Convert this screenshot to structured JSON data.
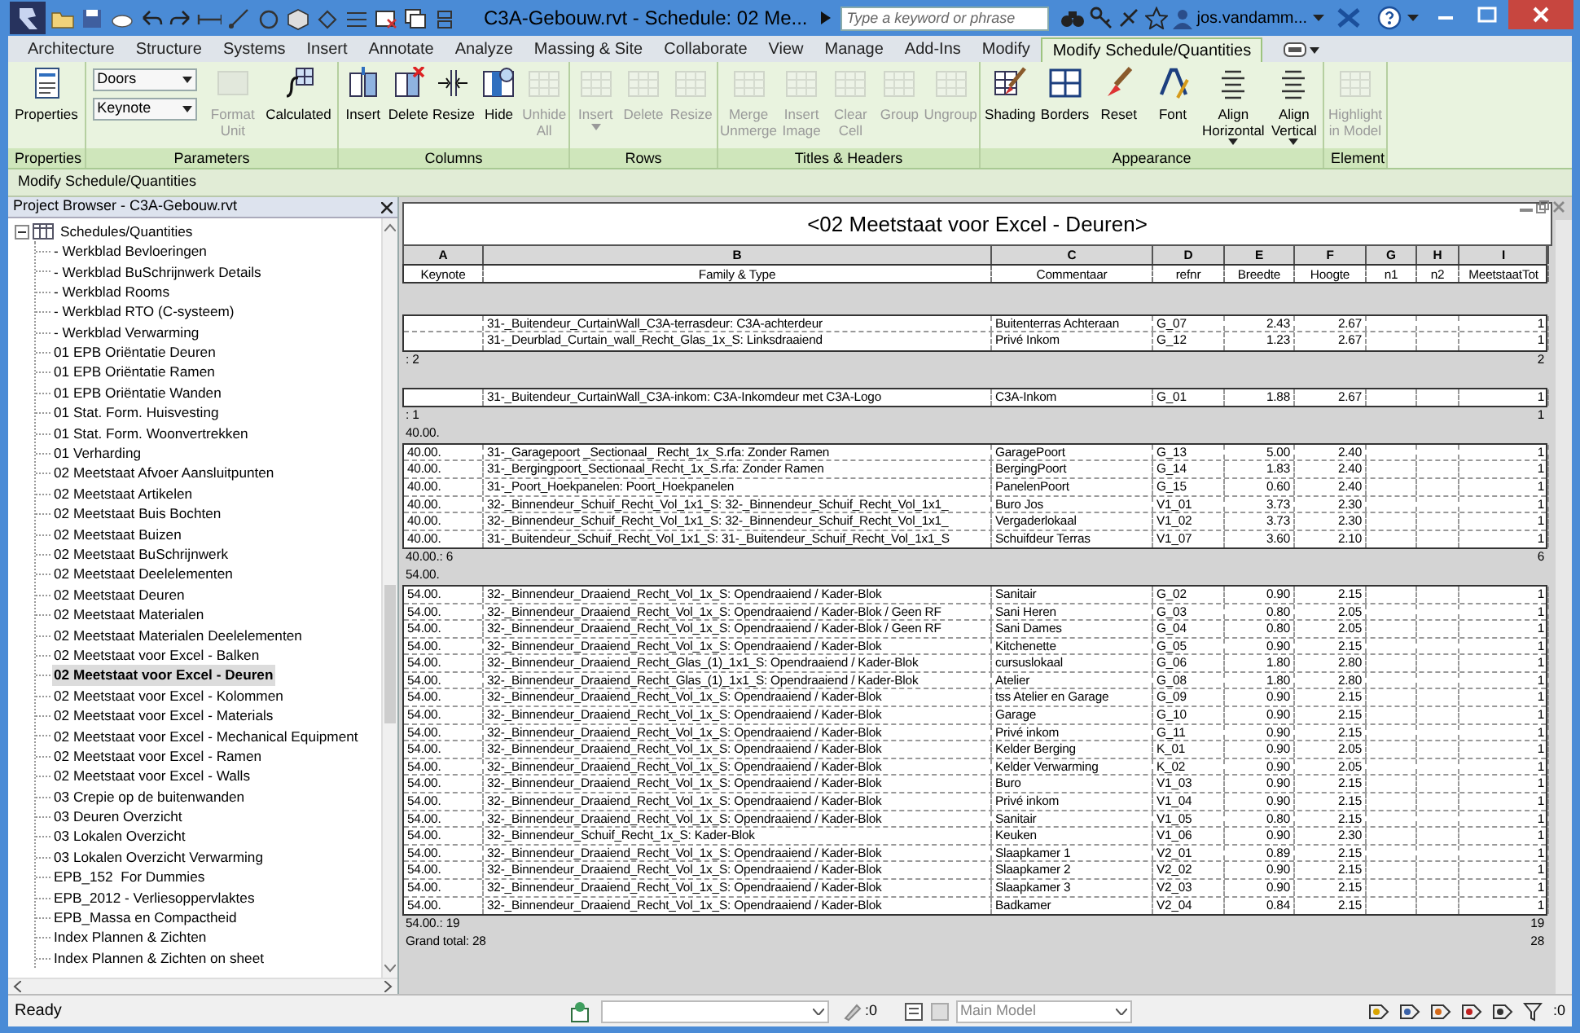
{
  "window": {
    "title": "C3A-Gebouw.rvt - Schedule: 02 Me...",
    "search_placeholder": "Type a keyword or phrase",
    "user": "jos.vandamm..."
  },
  "ribbon_tabs": [
    {
      "label": "Architecture",
      "selected": false
    },
    {
      "label": "Structure",
      "selected": false
    },
    {
      "label": "Systems",
      "selected": false
    },
    {
      "label": "Insert",
      "selected": false
    },
    {
      "label": "Annotate",
      "selected": false
    },
    {
      "label": "Analyze",
      "selected": false
    },
    {
      "label": "Massing & Site",
      "selected": false
    },
    {
      "label": "Collaborate",
      "selected": false
    },
    {
      "label": "View",
      "selected": false
    },
    {
      "label": "Manage",
      "selected": false
    },
    {
      "label": "Add-Ins",
      "selected": false
    },
    {
      "label": "Modify",
      "selected": false
    },
    {
      "label": "Modify Schedule/Quantities",
      "selected": true
    }
  ],
  "ribbon_panels": [
    {
      "title": "Properties",
      "buttons": [
        {
          "label": "Properties",
          "disabled": false,
          "has_menu": false
        }
      ]
    },
    {
      "title": "Parameters",
      "dropdowns": [
        "Doors",
        "Keynote"
      ],
      "buttons": [
        {
          "label": "Format Unit",
          "disabled": true,
          "has_menu": false
        },
        {
          "label": "Calculated",
          "disabled": false,
          "has_menu": false
        }
      ]
    },
    {
      "title": "Columns",
      "buttons": [
        {
          "label": "Insert",
          "disabled": false,
          "has_menu": false
        },
        {
          "label": "Delete",
          "disabled": false,
          "has_menu": false
        },
        {
          "label": "Resize",
          "disabled": false,
          "has_menu": false
        },
        {
          "label": "Hide",
          "disabled": false,
          "has_menu": false
        },
        {
          "label": "Unhide All",
          "disabled": true,
          "has_menu": false
        }
      ]
    },
    {
      "title": "Rows",
      "buttons": [
        {
          "label": "Insert",
          "disabled": true,
          "has_menu": true
        },
        {
          "label": "Delete",
          "disabled": true,
          "has_menu": false
        },
        {
          "label": "Resize",
          "disabled": true,
          "has_menu": false
        }
      ]
    },
    {
      "title": "Titles & Headers",
      "buttons": [
        {
          "label": "Merge Unmerge",
          "disabled": true,
          "has_menu": false
        },
        {
          "label": "Insert Image",
          "disabled": true,
          "has_menu": false
        },
        {
          "label": "Clear Cell",
          "disabled": true,
          "has_menu": false
        },
        {
          "label": "Group",
          "disabled": true,
          "has_menu": false
        },
        {
          "label": "Ungroup",
          "disabled": true,
          "has_menu": false
        }
      ]
    },
    {
      "title": "Appearance",
      "buttons": [
        {
          "label": "Shading",
          "disabled": false,
          "has_menu": false
        },
        {
          "label": "Borders",
          "disabled": false,
          "has_menu": false
        },
        {
          "label": "Reset",
          "disabled": false,
          "has_menu": false
        },
        {
          "label": "Font",
          "disabled": false,
          "has_menu": false
        },
        {
          "label": "Align Horizontal",
          "disabled": false,
          "has_menu": true
        },
        {
          "label": "Align Vertical",
          "disabled": false,
          "has_menu": true
        }
      ]
    },
    {
      "title": "Element",
      "buttons": [
        {
          "label": "Highlight in Model",
          "disabled": true,
          "has_menu": false
        }
      ]
    }
  ],
  "options_bar": "Modify Schedule/Quantities",
  "project_browser": {
    "title": "Project Browser - C3A-Gebouw.rvt",
    "tree": [
      {
        "label": "Schedules/Quantities",
        "expanded": true,
        "selected": false,
        "children": [
          {
            "label": "- Werkblad Bevloeringen",
            "selected": false
          },
          {
            "label": "- Werkblad BuSchrijnwerk Details",
            "selected": false
          },
          {
            "label": "- Werkblad Rooms",
            "selected": false
          },
          {
            "label": "- Werkblad RTO (C-systeem)",
            "selected": false
          },
          {
            "label": "- Werkblad Verwarming",
            "selected": false
          },
          {
            "label": "01 EPB Oriëntatie Deuren",
            "selected": false
          },
          {
            "label": "01 EPB Oriëntatie Ramen",
            "selected": false
          },
          {
            "label": "01 EPB Oriëntatie Wanden",
            "selected": false
          },
          {
            "label": "01 Stat. Form. Huisvesting",
            "selected": false
          },
          {
            "label": "01 Stat. Form. Woonvertrekken",
            "selected": false
          },
          {
            "label": "01 Verharding",
            "selected": false
          },
          {
            "label": "02 Meetstaat Afvoer Aansluitpunten",
            "selected": false
          },
          {
            "label": "02 Meetstaat Artikelen",
            "selected": false
          },
          {
            "label": "02 Meetstaat Buis Bochten",
            "selected": false
          },
          {
            "label": "02 Meetstaat Buizen",
            "selected": false
          },
          {
            "label": "02 Meetstaat BuSchrijnwerk",
            "selected": false
          },
          {
            "label": "02 Meetstaat Deelelementen",
            "selected": false
          },
          {
            "label": "02 Meetstaat Deuren",
            "selected": false
          },
          {
            "label": "02 Meetstaat Materialen",
            "selected": false
          },
          {
            "label": "02 Meetstaat Materialen Deelelementen",
            "selected": false
          },
          {
            "label": "02 Meetstaat voor Excel - Balken",
            "selected": false
          },
          {
            "label": "02 Meetstaat voor Excel - Deuren",
            "selected": true
          },
          {
            "label": "02 Meetstaat voor Excel - Kolommen",
            "selected": false
          },
          {
            "label": "02 Meetstaat voor Excel - Materials",
            "selected": false
          },
          {
            "label": "02 Meetstaat voor Excel - Mechanical Equipment",
            "selected": false
          },
          {
            "label": "02 Meetstaat voor Excel - Ramen",
            "selected": false
          },
          {
            "label": "02 Meetstaat voor Excel - Walls",
            "selected": false
          },
          {
            "label": "03 Crepie op de buitenwanden",
            "selected": false
          },
          {
            "label": "03 Deuren Overzicht",
            "selected": false
          },
          {
            "label": "03 Lokalen Overzicht",
            "selected": false
          },
          {
            "label": "03 Lokalen Overzicht Verwarming",
            "selected": false
          },
          {
            "label": "EPB_152  For Dummies",
            "selected": false
          },
          {
            "label": "EPB_2012 - Verliesoppervlaktes",
            "selected": false
          },
          {
            "label": "EPB_Massa en Compactheid",
            "selected": false
          },
          {
            "label": "Index Plannen & Zichten",
            "selected": false
          },
          {
            "label": "Index Plannen & Zichten on sheet",
            "selected": false
          }
        ]
      }
    ]
  },
  "schedule": {
    "title": "<02 Meetstaat voor Excel - Deuren>",
    "columns": [
      {
        "letter": "A",
        "heading": "Keynote"
      },
      {
        "letter": "B",
        "heading": "Family & Type"
      },
      {
        "letter": "C",
        "heading": "Commentaar"
      },
      {
        "letter": "D",
        "heading": "refnr"
      },
      {
        "letter": "E",
        "heading": "Breedte"
      },
      {
        "letter": "F",
        "heading": "Hoogte"
      },
      {
        "letter": "G",
        "heading": "n1"
      },
      {
        "letter": "H",
        "heading": "n2"
      },
      {
        "letter": "I",
        "heading": "MeetstaatTot"
      }
    ],
    "groups": [
      {
        "rows": [
          {
            "family_type": "31-_Buitendeur_CurtainWall_C3A-terrasdeur: C3A-achterdeur",
            "commentaar": "Buitenterras Achteraan",
            "refnr": "G_07",
            "breedte": "2.43",
            "hoogte": "2.67",
            "meetstaat_tot": "1"
          },
          {
            "family_type": "31-_Deurblad_Curtain_wall_Recht_Glas_1x_S: Linksdraaiend",
            "commentaar": "Privé Inkom",
            "refnr": "G_12",
            "breedte": "1.23",
            "hoogte": "2.67",
            "meetstaat_tot": "1"
          }
        ],
        "footer": ": 2",
        "count": "2"
      },
      {
        "rows": [
          {
            "family_type": "31-_Buitendeur_CurtainWall_C3A-inkom: C3A-Inkomdeur met C3A-Logo",
            "commentaar": "C3A-Inkom",
            "refnr": "G_01",
            "breedte": "1.88",
            "hoogte": "2.67",
            "meetstaat_tot": "1"
          }
        ],
        "footer": ": 1",
        "count": "1"
      },
      {
        "header": "40.00.",
        "rows": [
          {
            "keynote": "40.00.",
            "family_type": "31-_Garagepoort _Sectionaal_ Recht_1x_S.rfa: Zonder Ramen",
            "commentaar": "GaragePoort",
            "refnr": "G_13",
            "breedte": "5.00",
            "hoogte": "2.40",
            "meetstaat_tot": "1"
          },
          {
            "keynote": "40.00.",
            "family_type": "31-_Bergingpoort_Sectionaal_Recht_1x_S.rfa: Zonder Ramen",
            "commentaar": "BergingPoort",
            "refnr": "G_14",
            "breedte": "1.83",
            "hoogte": "2.40",
            "meetstaat_tot": "1"
          },
          {
            "keynote": "40.00.",
            "family_type": "31-_Poort_Hoekpanelen: Poort_Hoekpanelen",
            "commentaar": "PanelenPoort",
            "refnr": "G_15",
            "breedte": "0.60",
            "hoogte": "2.40",
            "meetstaat_tot": "1"
          },
          {
            "keynote": "40.00.",
            "family_type": "32-_Binnendeur_Schuif_Recht_Vol_1x1_S: 32-_Binnendeur_Schuif_Recht_Vol_1x1_",
            "commentaar": "Buro Jos",
            "refnr": "V1_01",
            "breedte": "3.73",
            "hoogte": "2.30",
            "meetstaat_tot": "1"
          },
          {
            "keynote": "40.00.",
            "family_type": "32-_Binnendeur_Schuif_Recht_Vol_1x1_S: 32-_Binnendeur_Schuif_Recht_Vol_1x1_",
            "commentaar": "Vergaderlokaal",
            "refnr": "V1_02",
            "breedte": "3.73",
            "hoogte": "2.30",
            "meetstaat_tot": "1"
          },
          {
            "keynote": "40.00.",
            "family_type": "31-_Buitendeur_Schuif_Recht_Vol_1x1_S: 31-_Buitendeur_Schuif_Recht_Vol_1x1_S",
            "commentaar": "Schuifdeur Terras",
            "refnr": "V1_07",
            "breedte": "3.60",
            "hoogte": "2.10",
            "meetstaat_tot": "1"
          }
        ],
        "footer": "40.00.: 6",
        "count": "6"
      },
      {
        "header": "54.00.",
        "rows": [
          {
            "keynote": "54.00.",
            "family_type": "32-_Binnendeur_Draaiend_Recht_Vol_1x_S: Opendraaiend / Kader-Blok",
            "commentaar": "Sanitair",
            "refnr": "G_02",
            "breedte": "0.90",
            "hoogte": "2.15",
            "meetstaat_tot": "1"
          },
          {
            "keynote": "54.00.",
            "family_type": "32-_Binnendeur_Draaiend_Recht_Vol_1x_S: Opendraaiend / Kader-Blok / Geen RF",
            "commentaar": "Sani Heren",
            "refnr": "G_03",
            "breedte": "0.80",
            "hoogte": "2.05",
            "meetstaat_tot": "1"
          },
          {
            "keynote": "54.00.",
            "family_type": "32-_Binnendeur_Draaiend_Recht_Vol_1x_S: Opendraaiend / Kader-Blok / Geen RF",
            "commentaar": "Sani Dames",
            "refnr": "G_04",
            "breedte": "0.80",
            "hoogte": "2.05",
            "meetstaat_tot": "1"
          },
          {
            "keynote": "54.00.",
            "family_type": "32-_Binnendeur_Draaiend_Recht_Vol_1x_S: Opendraaiend / Kader-Blok",
            "commentaar": "Kitchenette",
            "refnr": "G_05",
            "breedte": "0.90",
            "hoogte": "2.15",
            "meetstaat_tot": "1"
          },
          {
            "keynote": "54.00.",
            "family_type": "32-_Binnendeur_Draaiend_Recht_Glas_(1)_1x1_S: Opendraaiend / Kader-Blok",
            "commentaar": "cursuslokaal",
            "refnr": "G_06",
            "breedte": "1.80",
            "hoogte": "2.80",
            "meetstaat_tot": "1"
          },
          {
            "keynote": "54.00.",
            "family_type": "32-_Binnendeur_Draaiend_Recht_Glas_(1)_1x1_S: Opendraaiend / Kader-Blok",
            "commentaar": "Atelier",
            "refnr": "G_08",
            "breedte": "1.80",
            "hoogte": "2.80",
            "meetstaat_tot": "1"
          },
          {
            "keynote": "54.00.",
            "family_type": "32-_Binnendeur_Draaiend_Recht_Vol_1x_S: Opendraaiend / Kader-Blok",
            "commentaar": "tss Atelier en Garage",
            "refnr": "G_09",
            "breedte": "0.90",
            "hoogte": "2.15",
            "meetstaat_tot": "1"
          },
          {
            "keynote": "54.00.",
            "family_type": "32-_Binnendeur_Draaiend_Recht_Vol_1x_S: Opendraaiend / Kader-Blok",
            "commentaar": "Garage",
            "refnr": "G_10",
            "breedte": "0.90",
            "hoogte": "2.15",
            "meetstaat_tot": "1"
          },
          {
            "keynote": "54.00.",
            "family_type": "32-_Binnendeur_Draaiend_Recht_Vol_1x_S: Opendraaiend / Kader-Blok",
            "commentaar": "Privé inkom",
            "refnr": "G_11",
            "breedte": "0.90",
            "hoogte": "2.15",
            "meetstaat_tot": "1"
          },
          {
            "keynote": "54.00.",
            "family_type": "32-_Binnendeur_Draaiend_Recht_Vol_1x_S: Opendraaiend / Kader-Blok",
            "commentaar": "Kelder Berging",
            "refnr": "K_01",
            "breedte": "0.90",
            "hoogte": "2.05",
            "meetstaat_tot": "1"
          },
          {
            "keynote": "54.00.",
            "family_type": "32-_Binnendeur_Draaiend_Recht_Vol_1x_S: Opendraaiend / Kader-Blok",
            "commentaar": "Kelder Verwarming",
            "refnr": "K_02",
            "breedte": "0.90",
            "hoogte": "2.05",
            "meetstaat_tot": "1"
          },
          {
            "keynote": "54.00.",
            "family_type": "32-_Binnendeur_Draaiend_Recht_Vol_1x_S: Opendraaiend / Kader-Blok",
            "commentaar": "Buro",
            "refnr": "V1_03",
            "breedte": "0.90",
            "hoogte": "2.15",
            "meetstaat_tot": "1"
          },
          {
            "keynote": "54.00.",
            "family_type": "32-_Binnendeur_Draaiend_Recht_Vol_1x_S: Opendraaiend / Kader-Blok",
            "commentaar": "Privé inkom",
            "refnr": "V1_04",
            "breedte": "0.90",
            "hoogte": "2.15",
            "meetstaat_tot": "1"
          },
          {
            "keynote": "54.00.",
            "family_type": "32-_Binnendeur_Draaiend_Recht_Vol_1x_S: Opendraaiend / Kader-Blok",
            "commentaar": "Sanitair",
            "refnr": "V1_05",
            "breedte": "0.80",
            "hoogte": "2.15",
            "meetstaat_tot": "1"
          },
          {
            "keynote": "54.00.",
            "family_type": "32-_Binnendeur_Schuif_Recht_1x_S: Kader-Blok",
            "commentaar": "Keuken",
            "refnr": "V1_06",
            "breedte": "0.90",
            "hoogte": "2.30",
            "meetstaat_tot": "1"
          },
          {
            "keynote": "54.00.",
            "family_type": "32-_Binnendeur_Draaiend_Recht_Vol_1x_S: Opendraaiend / Kader-Blok",
            "commentaar": "Slaapkamer 1",
            "refnr": "V2_01",
            "breedte": "0.89",
            "hoogte": "2.15",
            "meetstaat_tot": "1"
          },
          {
            "keynote": "54.00.",
            "family_type": "32-_Binnendeur_Draaiend_Recht_Vol_1x_S: Opendraaiend / Kader-Blok",
            "commentaar": "Slaapkamer 2",
            "refnr": "V2_02",
            "breedte": "0.90",
            "hoogte": "2.15",
            "meetstaat_tot": "1"
          },
          {
            "keynote": "54.00.",
            "family_type": "32-_Binnendeur_Draaiend_Recht_Vol_1x_S: Opendraaiend / Kader-Blok",
            "commentaar": "Slaapkamer 3",
            "refnr": "V2_03",
            "breedte": "0.90",
            "hoogte": "2.15",
            "meetstaat_tot": "1"
          },
          {
            "keynote": "54.00.",
            "family_type": "32-_Binnendeur_Draaiend_Recht_Vol_1x_S: Opendraaiend / Kader-Blok",
            "commentaar": "Badkamer",
            "refnr": "V2_04",
            "breedte": "0.84",
            "hoogte": "2.15",
            "meetstaat_tot": "1"
          }
        ],
        "footer": "54.00.: 19",
        "count": "19"
      }
    ],
    "grand_total": {
      "label": "Grand total: 28",
      "count": "28"
    }
  },
  "status_bar": {
    "message": "Ready",
    "warnings_count": ":0",
    "model": "Main Model",
    "filter_count": ":0"
  }
}
